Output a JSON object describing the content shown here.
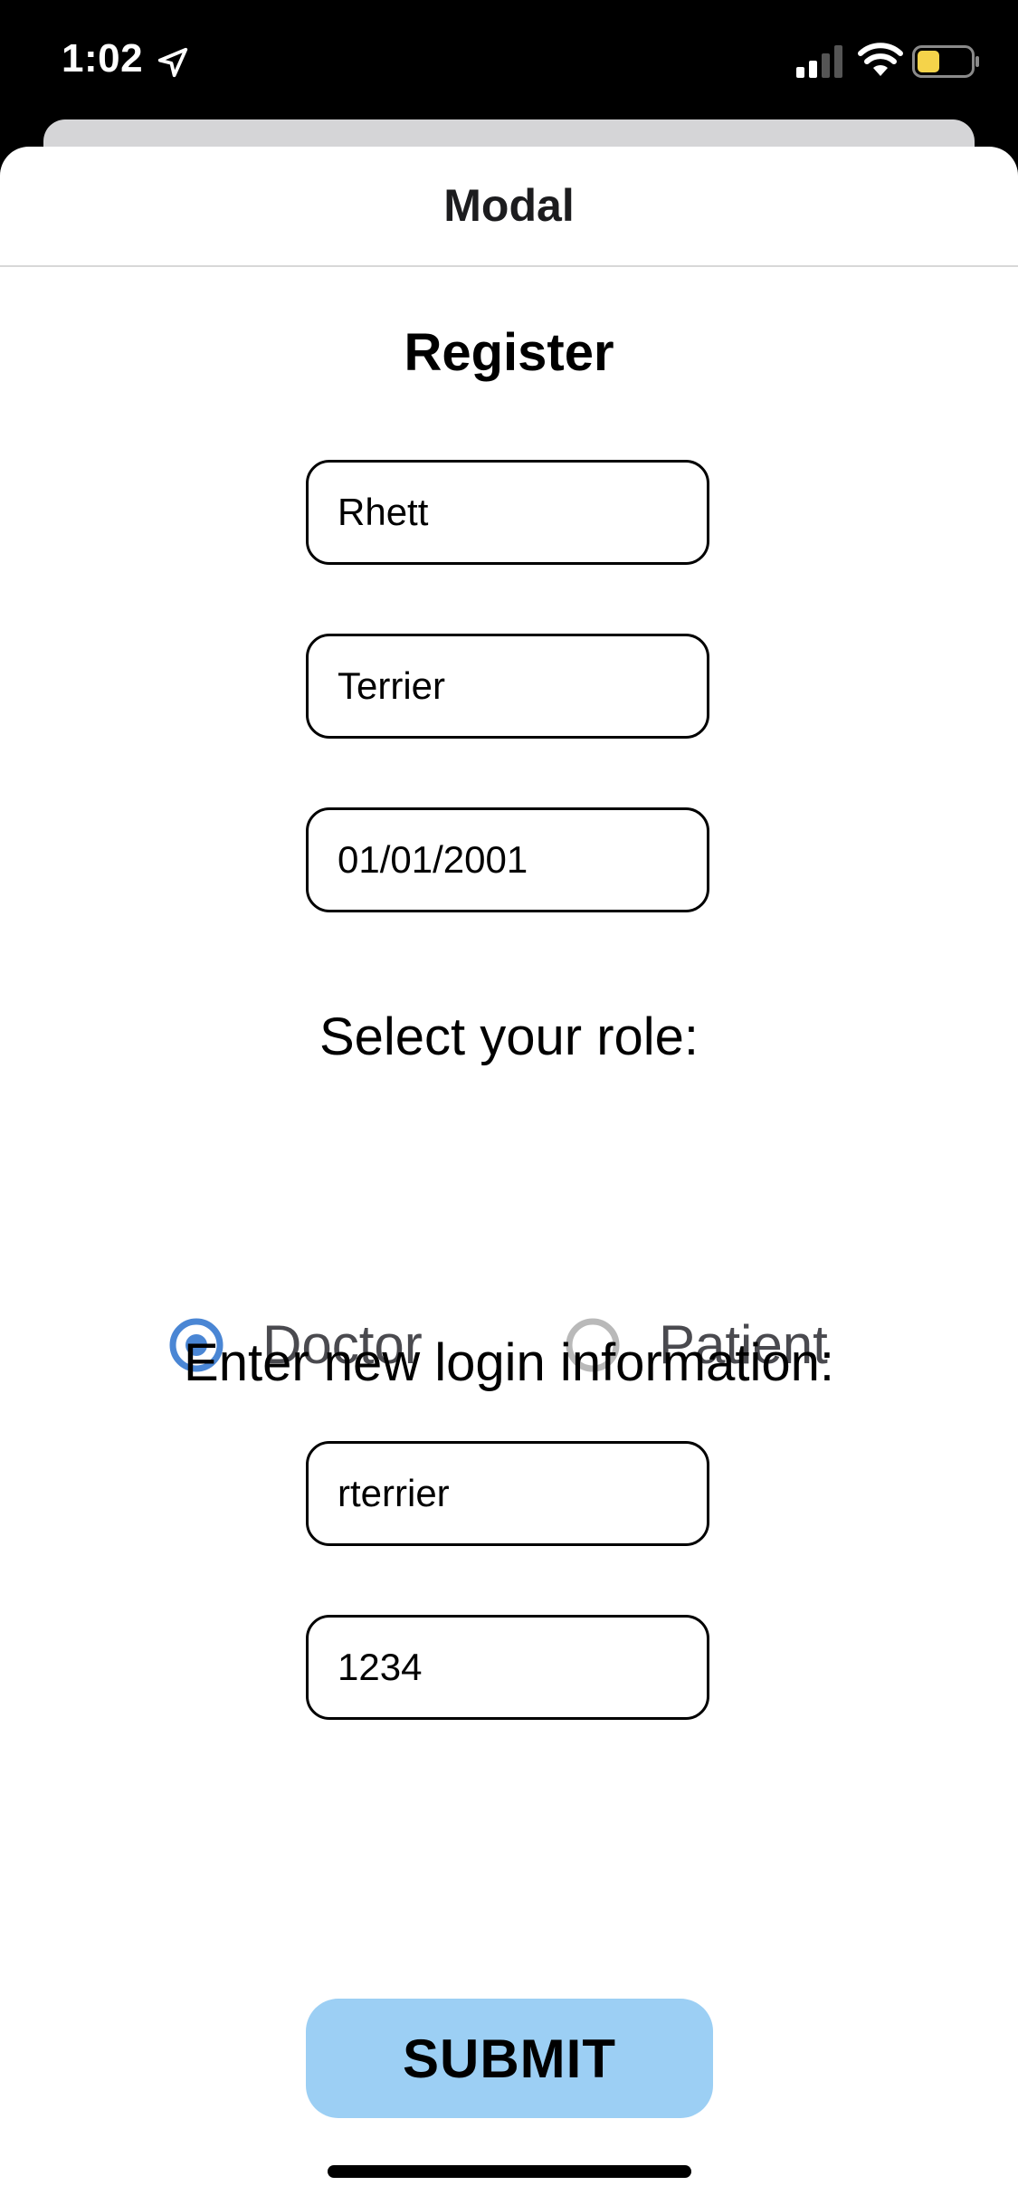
{
  "status_bar": {
    "time": "1:02",
    "icons": [
      "location-arrow-icon",
      "cellular-signal-icon",
      "wifi-icon",
      "battery-icon"
    ],
    "battery_color": "#f5d34a"
  },
  "modal": {
    "title": "Modal"
  },
  "form": {
    "title": "Register",
    "first_name": "Rhett",
    "last_name": "Terrier",
    "date_of_birth": "01/01/2001",
    "role_prompt": "Select your role:",
    "roles": [
      {
        "label": "Doctor",
        "selected": true
      },
      {
        "label": "Patient",
        "selected": false
      }
    ],
    "login_prompt": "Enter new login information:",
    "username": "rterrier",
    "password": "1234",
    "submit_label": "SUBMIT"
  },
  "colors": {
    "radio_selected": "#4a86d4",
    "radio_unselected": "#b9b9b9",
    "submit_background": "#9ccff4"
  }
}
